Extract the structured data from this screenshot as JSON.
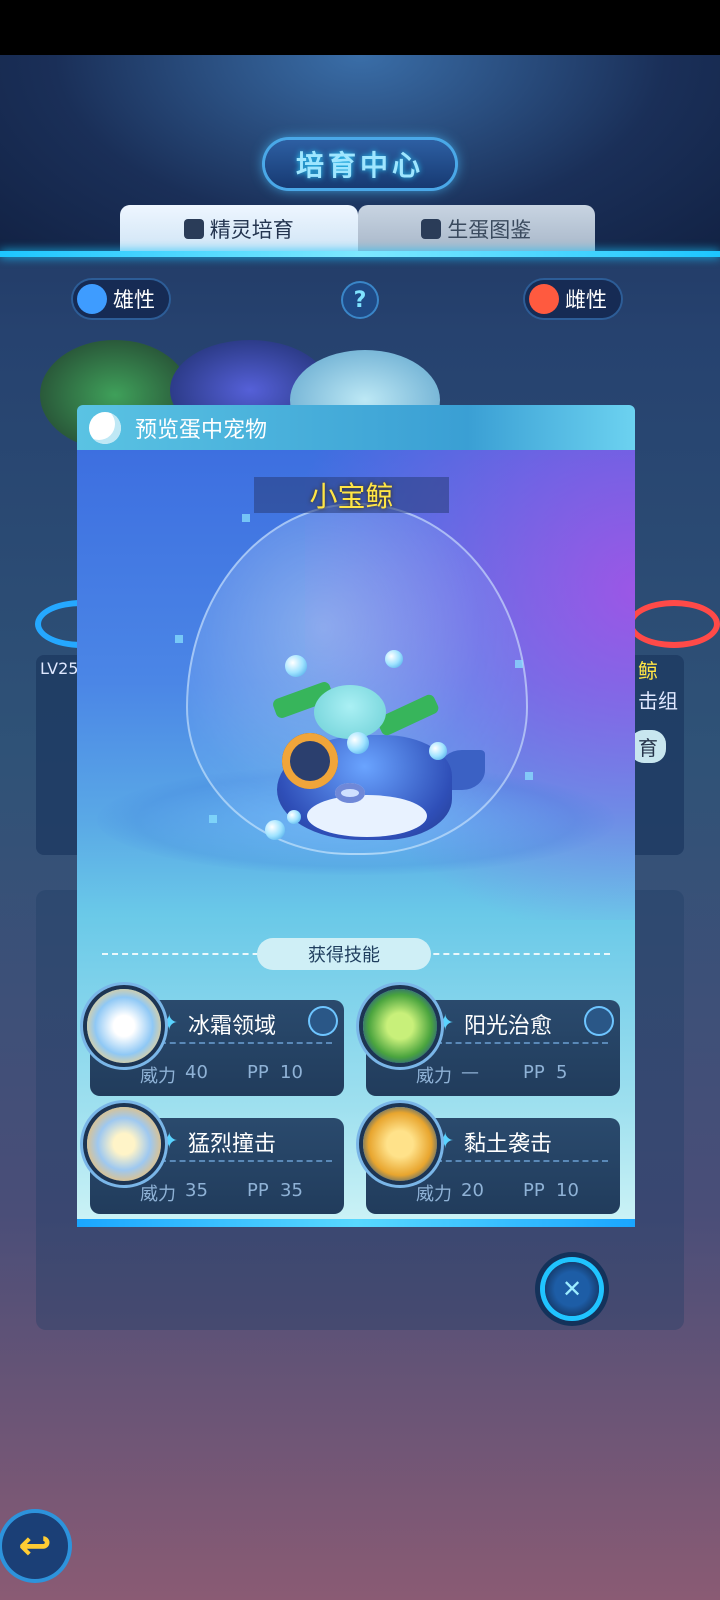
{
  "header": {
    "title": "培育中心"
  },
  "tabs": [
    {
      "label": "精灵培育",
      "active": true
    },
    {
      "label": "生蛋图鉴",
      "active": false
    }
  ],
  "parents": {
    "male_label": "雄性",
    "female_label": "雌性",
    "help": "?",
    "left_level": "LV25",
    "right_text_1": "鲸",
    "right_text_2": "击组",
    "right_button": "育"
  },
  "modal": {
    "title": "预览蛋中宠物",
    "pet_name": "小宝鲸",
    "skills_header": "获得技能",
    "skills": [
      {
        "name": "冰霜领域",
        "power_label": "威力",
        "power": "40",
        "pp_label": "PP",
        "pp": "10",
        "icon": "snowflake-icon",
        "has_link": true
      },
      {
        "name": "阳光治愈",
        "power_label": "威力",
        "power": "—",
        "pp_label": "PP",
        "pp": "5",
        "icon": "leaf-icon",
        "has_link": true
      },
      {
        "name": "猛烈撞击",
        "power_label": "威力",
        "power": "35",
        "pp_label": "PP",
        "pp": "35",
        "icon": "impact-icon",
        "has_link": false
      },
      {
        "name": "黏土袭击",
        "power_label": "威力",
        "power": "20",
        "pp_label": "PP",
        "pp": "10",
        "icon": "clay-icon",
        "has_link": false
      }
    ]
  },
  "colors": {
    "accent": "#1dc6ff",
    "pet_name": "#ffe545",
    "male": "#3e9cff",
    "female": "#ff5a3f"
  }
}
